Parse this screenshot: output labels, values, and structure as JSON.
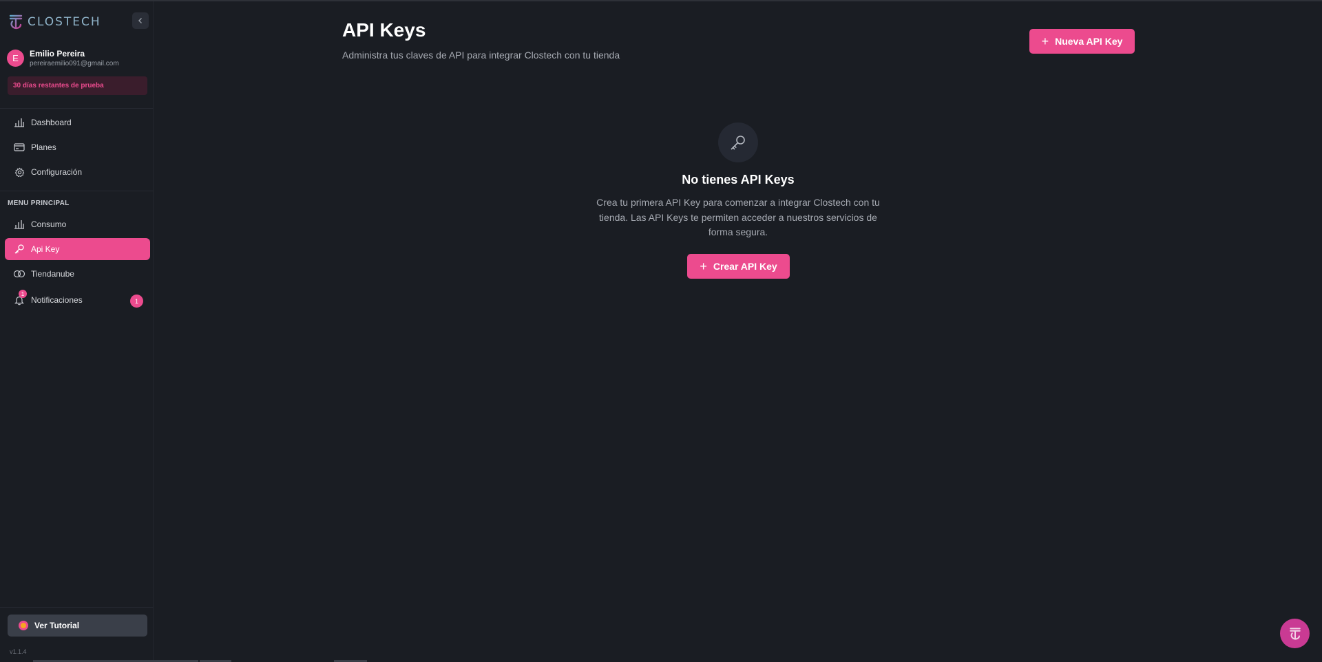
{
  "app": {
    "name": "CLOSTECH",
    "version": "v1.1.4"
  },
  "user": {
    "initial": "E",
    "name": "Emilio Pereira",
    "email": "pereiraemilio091@gmail.com",
    "trial_text": "30 días restantes de prueba"
  },
  "nav_top": [
    {
      "label": "Dashboard",
      "icon": "bar-chart-icon"
    },
    {
      "label": "Planes",
      "icon": "credit-card-icon"
    },
    {
      "label": "Configuración",
      "icon": "gear-icon"
    }
  ],
  "section_label": "MENU PRINCIPAL",
  "nav_main": [
    {
      "label": "Consumo",
      "icon": "bar-chart-icon"
    },
    {
      "label": "Api Key",
      "icon": "key-icon",
      "active": true
    },
    {
      "label": "Tiendanube",
      "icon": "cloud-icon"
    },
    {
      "label": "Notificaciones",
      "icon": "bell-icon",
      "badge": "1",
      "count": "1"
    }
  ],
  "tutorial_label": "Ver Tutorial",
  "main": {
    "title": "API Keys",
    "subtitle": "Administra tus claves de API para integrar Clostech con tu tienda",
    "new_button": "Nueva API Key",
    "empty_title": "No tienes API Keys",
    "empty_desc": "Crea tu primera API Key para comenzar a integrar Clostech con tu tienda. Las API Keys te permiten acceder a nuestros servicios de forma segura.",
    "create_button": "Crear API Key"
  },
  "colors": {
    "accent": "#ec4b8e",
    "background": "#1a1d23",
    "trial_bg": "#3a1d2c"
  }
}
